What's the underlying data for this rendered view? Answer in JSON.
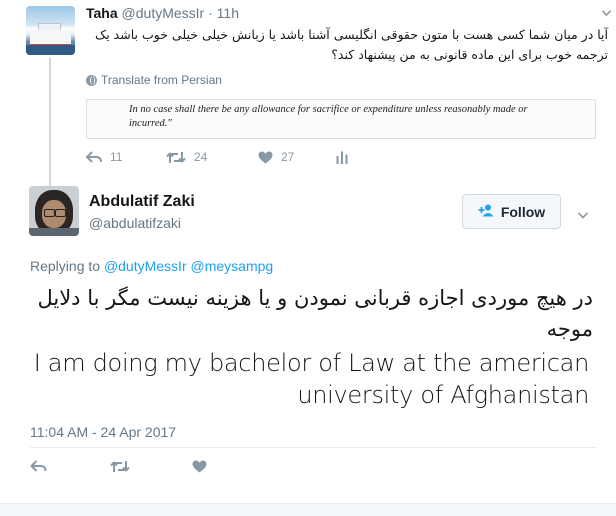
{
  "parent_tweet": {
    "name": "Taha",
    "handle": "@dutyMessIr",
    "separator": "·",
    "time": "11h",
    "text": "آیا در میان شما کسی هست با متون حقوقی انگلیسی آشنا باشد یا زبانش خیلی خیلی خوب باشد یک ترجمه خوب برای این ماده قانونی به من پیشنهاد کند؟",
    "translate_label": "Translate from Persian",
    "quote_image_text": "In no case shall there be any allowance for sacrifice or expenditure unless reasonably made or incurred.\"",
    "replies": "11",
    "retweets": "24",
    "likes": "27"
  },
  "main_tweet": {
    "name": "Abdulatif Zaki",
    "handle": "@abdulatifzaki",
    "follow_label": "Follow",
    "replying_prefix": "Replying to",
    "replying_mentions": "@dutyMessIr @meysampg",
    "text_persian": "در هیچ موردی اجازه قربانی نمودن و یا هزینه نیست مگر با دلایل موجه",
    "text_english": "I am doing my bachelor of Law at the american university of Afghanistan",
    "timestamp": "11:04 AM - 24 Apr 2017"
  },
  "icons": {
    "reply": "reply-icon",
    "retweet": "retweet-icon",
    "like": "heart-icon",
    "analytics": "analytics-icon",
    "more": "chevron-down-icon",
    "translate": "globe-icon",
    "follow": "add-user-icon"
  },
  "colors": {
    "link_blue": "#1da1f2",
    "secondary_text": "#657786",
    "icon_gray": "#8899a6",
    "thread_line": "#ccd6dd"
  }
}
